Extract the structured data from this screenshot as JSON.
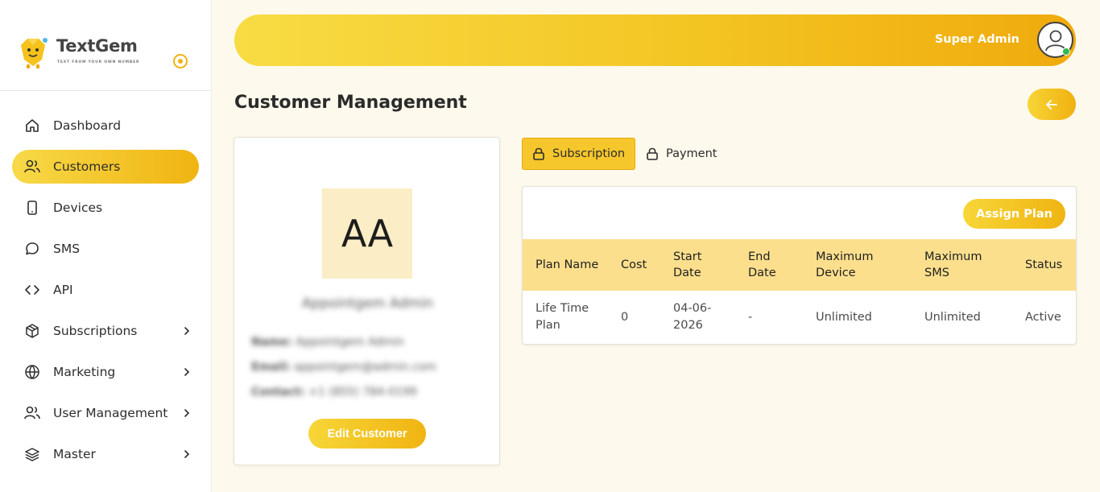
{
  "brand": {
    "name": "TextGem",
    "tagline": "TEXT FROM YOUR OWN NUMBER",
    "accent": "#f0b411",
    "accent_light": "#f7d948"
  },
  "sidebar": {
    "items": [
      {
        "label": "Dashboard",
        "icon": "home-icon",
        "active": false,
        "has_submenu": false
      },
      {
        "label": "Customers",
        "icon": "users-icon",
        "active": true,
        "has_submenu": false
      },
      {
        "label": "Devices",
        "icon": "phone-icon",
        "active": false,
        "has_submenu": false
      },
      {
        "label": "SMS",
        "icon": "chat-icon",
        "active": false,
        "has_submenu": false
      },
      {
        "label": "API",
        "icon": "code-icon",
        "active": false,
        "has_submenu": false
      },
      {
        "label": "Subscriptions",
        "icon": "box-icon",
        "active": false,
        "has_submenu": true
      },
      {
        "label": "Marketing",
        "icon": "globe-icon",
        "active": false,
        "has_submenu": true
      },
      {
        "label": "User Management",
        "icon": "users-icon",
        "active": false,
        "has_submenu": true
      },
      {
        "label": "Master",
        "icon": "layers-icon",
        "active": false,
        "has_submenu": true
      }
    ]
  },
  "header": {
    "user_name": "Super Admin"
  },
  "page": {
    "title": "Customer Management"
  },
  "customer": {
    "initials": "AA",
    "display_name": "Appointgem Admin",
    "name_label": "Name:",
    "name_value": "Appointgem Admin",
    "email_label": "Email:",
    "email_value": "appointgem@admin.com",
    "contact_label": "Contact:",
    "contact_value": "+1 (855) 784-0199",
    "edit_label": "Edit Customer"
  },
  "tabs": [
    {
      "label": "Subscription",
      "active": true
    },
    {
      "label": "Payment",
      "active": false
    }
  ],
  "plans": {
    "assign_label": "Assign Plan",
    "columns": [
      "Plan Name",
      "Cost",
      "Start Date",
      "End Date",
      "Maximum Device",
      "Maximum SMS",
      "Status"
    ],
    "rows": [
      [
        "Life Time Plan",
        "0",
        "04-06-2026",
        "-",
        "Unlimited",
        "Unlimited",
        "Active"
      ]
    ]
  }
}
